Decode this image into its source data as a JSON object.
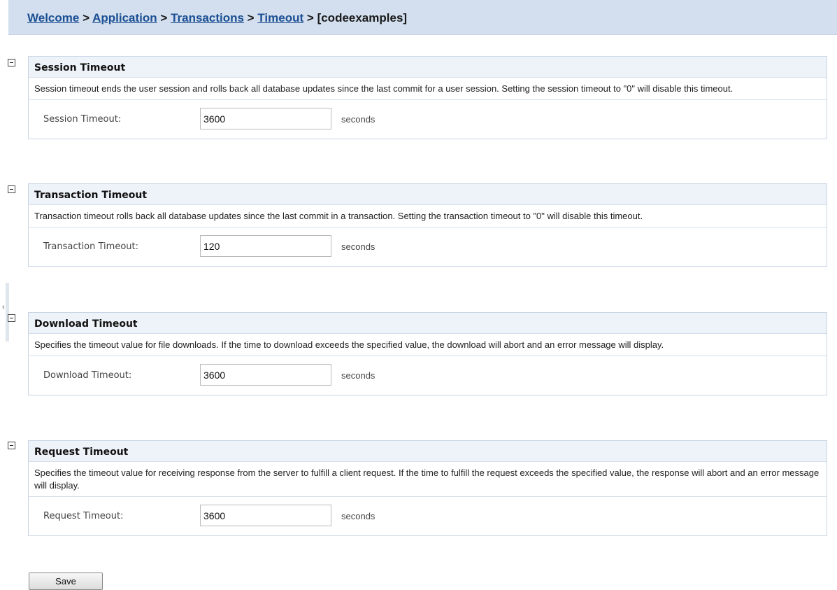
{
  "breadcrumb": {
    "items": [
      "Welcome",
      "Application",
      "Transactions",
      "Timeout"
    ],
    "separator": ">",
    "current": "[codeexamples]"
  },
  "sections": [
    {
      "title": "Session Timeout",
      "description": "Session timeout ends the user session and rolls back all database updates since the last commit for a user session. Setting the session timeout to \"0\" will disable this timeout.",
      "field_label": "Session Timeout:",
      "value": "3600",
      "unit": "seconds"
    },
    {
      "title": "Transaction Timeout",
      "description": "Transaction timeout rolls back all database updates since the last commit in a transaction. Setting the transaction timeout to \"0\" will disable this timeout.",
      "field_label": "Transaction Timeout:",
      "value": "120",
      "unit": "seconds"
    },
    {
      "title": "Download Timeout",
      "description": "Specifies the timeout value for file downloads. If the time to download exceeds the specified value, the download will abort and an error message will display.",
      "field_label": "Download Timeout:",
      "value": "3600",
      "unit": "seconds"
    },
    {
      "title": "Request Timeout",
      "description": "Specifies the timeout value for receiving response from the server to fulfill a client request. If the time to fulfill the request exceeds the specified value, the response will abort and an error message will display.",
      "field_label": "Request Timeout:",
      "value": "3600",
      "unit": "seconds"
    }
  ],
  "actions": {
    "save_label": "Save"
  },
  "icons": {
    "collapse": "collapse-icon",
    "sidebar_toggle": "chevron-left-icon"
  },
  "colors": {
    "breadcrumb_bar": "#d3dfee",
    "link": "#1b4f93",
    "section_header": "#eef3f9",
    "section_border": "#c9d6e5"
  }
}
